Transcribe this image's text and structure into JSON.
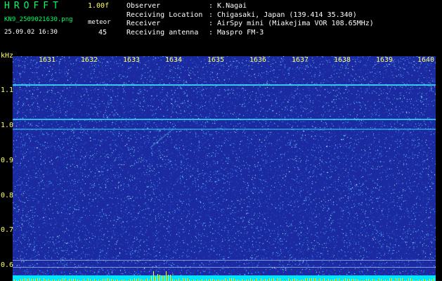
{
  "header": {
    "app_title": "HROFFT",
    "version": "1.00f",
    "filename": "KN9_2509021630.png",
    "datetime": "25.09.02 16:30",
    "meteor_label": "meteor",
    "meteor_count": "45"
  },
  "info": [
    {
      "label": "Observer",
      "value": ": K.Nagai"
    },
    {
      "label": "Receiving Location",
      "value": ": Chigasaki, Japan (139.414 35.340)"
    },
    {
      "label": "Receiver",
      "value": ": AirSpy mini (Miakejima VOR 108.65MHz)"
    },
    {
      "label": "Receiving antenna",
      "value": ": Maspro FM-3"
    }
  ],
  "plot": {
    "y_unit": "kHz",
    "time_ticks": [
      "1631",
      "1632",
      "1633",
      "1634",
      "1635",
      "1636",
      "1637",
      "1638",
      "1639",
      "1640"
    ],
    "y_ticks": [
      "1.1",
      "1.0",
      "0.9",
      "0.8",
      "0.7",
      "0.6"
    ],
    "colors": {
      "background": "#1b2aa0",
      "noise": "#4fd0ff",
      "signal": "#3ff0ff",
      "axis": "#ffff66",
      "bar": "#00e5ff"
    }
  }
}
